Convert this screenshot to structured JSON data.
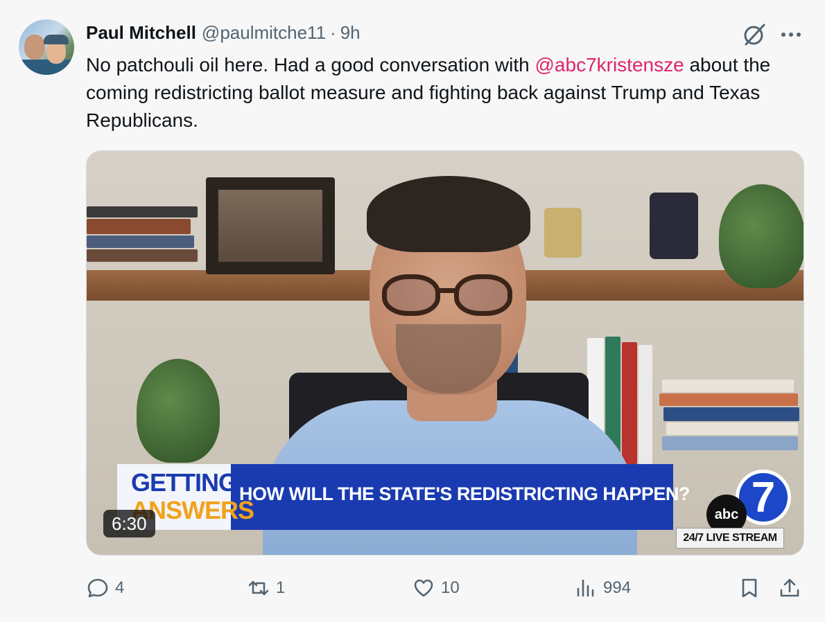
{
  "tweet": {
    "author_name": "Paul Mitchell",
    "handle": "@paulmitche11",
    "separator": "·",
    "time": "9h",
    "text_before": "No patchouli oil here.  Had a good conversation with ",
    "mention": "@abc7kristensze",
    "text_after": " about the coming redistricting ballot measure and fighting back against Trump and Texas Republicans."
  },
  "media": {
    "lower_third_line1": "GETTING",
    "lower_third_line2": "ANSWERS",
    "headline": "HOW WILL THE STATE'S REDISTRICTING HAPPEN?",
    "duration": "6:30",
    "network": "abc",
    "channel_number": "7",
    "stream_label": "24/7 LIVE STREAM"
  },
  "actions": {
    "replies": "4",
    "reposts": "1",
    "likes": "10",
    "views": "994"
  },
  "colors": {
    "mention": "#e0246b",
    "secondary_text": "#536471",
    "lower_third_blue": "#1a3bb0",
    "answers_orange": "#f2a21a"
  },
  "icons": {
    "grok": "grok-icon",
    "more": "more-icon",
    "reply": "reply-icon",
    "repost": "repost-icon",
    "like": "heart-icon",
    "views": "views-icon",
    "bookmark": "bookmark-icon",
    "share": "share-icon"
  }
}
